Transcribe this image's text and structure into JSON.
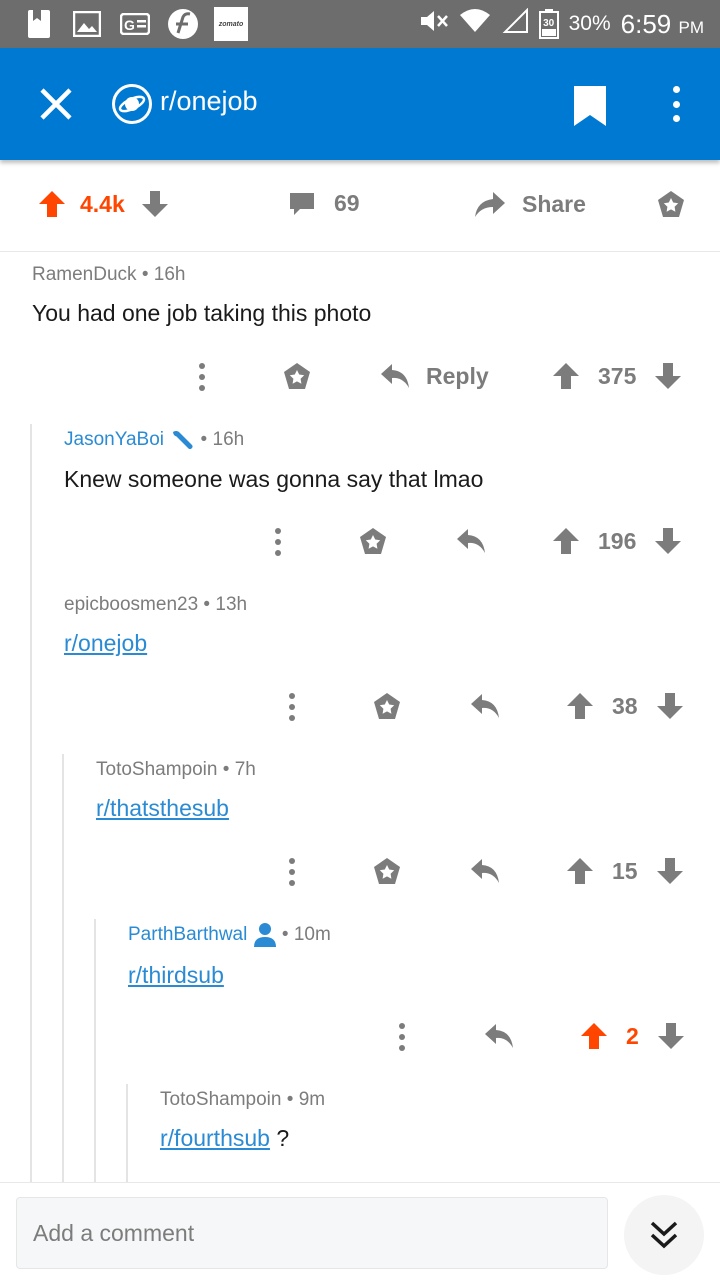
{
  "status_bar": {
    "zomato": "zomato",
    "badge": "30",
    "battery": "30%",
    "time": "6:59",
    "ampm": "PM"
  },
  "app_bar": {
    "subreddit": "r/onejob"
  },
  "post_actions": {
    "score": "4.4k",
    "comments": "69",
    "share": "Share"
  },
  "comments": [
    {
      "author": "RamenDuck",
      "age": "16h",
      "body": "You had one job taking this photo",
      "reply": "Reply",
      "score": "375"
    },
    {
      "author": "JasonYaBoi",
      "age": "16h",
      "body": "Knew someone was gonna say that lmao",
      "score": "196"
    },
    {
      "author": "epicboosmen23",
      "age": "13h",
      "link": "r/onejob",
      "score": "38"
    },
    {
      "author": "TotoShampoin",
      "age": "7h",
      "link": "r/thatsthesub",
      "score": "15"
    },
    {
      "author": "ParthBarthwal",
      "age": "10m",
      "link": "r/thirdsub",
      "score": "2"
    },
    {
      "author": "TotoShampoin",
      "age": "9m",
      "link": "r/fourthsub",
      "suffix": "?"
    }
  ],
  "bottom_bar": {
    "placeholder": "Add a comment"
  },
  "colors": {
    "brand": "#0079d3",
    "upvote": "#ff4500",
    "link": "#2a8bd4",
    "muted": "#7c7c7c"
  }
}
